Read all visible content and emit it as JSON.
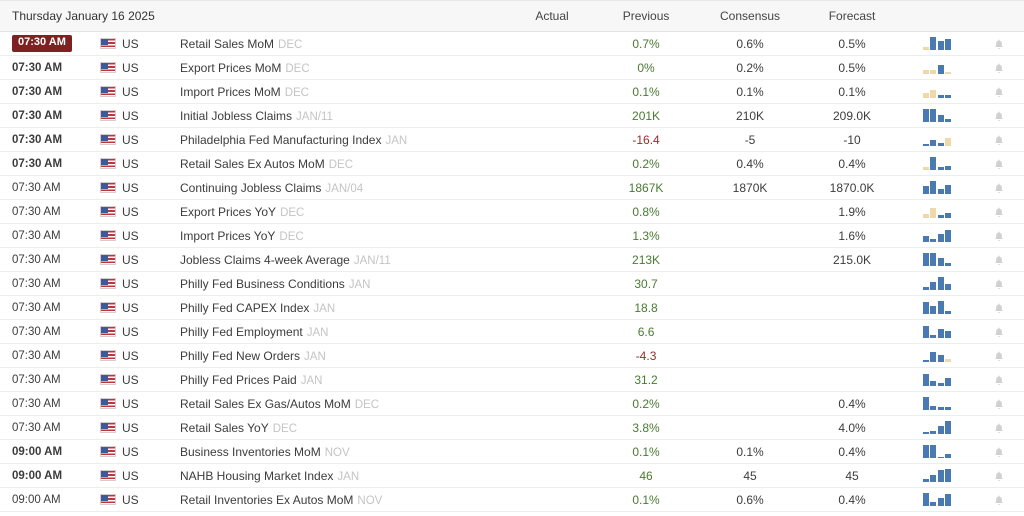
{
  "header": {
    "date_title": "Thursday January 16 2025",
    "columns": {
      "actual": "Actual",
      "previous": "Previous",
      "consensus": "Consensus",
      "forecast": "Forecast"
    }
  },
  "colors": {
    "previous_positive": "#4a7a33",
    "previous_negative": "#9b2a2a",
    "highlight_badge": "#7d2221",
    "spark_blue": "#4a7ab2",
    "spark_tan": "#f0d9a8",
    "header_bg": "#f7f7f7",
    "row_border": "#ededed",
    "reference_text": "#c4c4c4"
  },
  "icons": {
    "flag": "us-flag-icon",
    "alert": "bell-icon",
    "chart": "sparkline-bar-chart-icon"
  },
  "rows": [
    {
      "time": "07:30 AM",
      "time_highlighted": true,
      "time_bold": true,
      "country": "US",
      "event": "Retail Sales MoM",
      "reference": "DEC",
      "actual": "",
      "previous": "0.7%",
      "previous_negative": false,
      "consensus": "0.6%",
      "forecast": "0.5%",
      "spark": [
        {
          "h": 3,
          "tan": true
        },
        {
          "h": 13,
          "tan": false
        },
        {
          "h": 9,
          "tan": false
        },
        {
          "h": 11,
          "tan": false
        }
      ]
    },
    {
      "time": "07:30 AM",
      "time_highlighted": false,
      "time_bold": true,
      "country": "US",
      "event": "Export Prices MoM",
      "reference": "DEC",
      "actual": "",
      "previous": "0%",
      "previous_negative": false,
      "consensus": "0.2%",
      "forecast": "0.5%",
      "spark": [
        {
          "h": 4,
          "tan": true
        },
        {
          "h": 4,
          "tan": true
        },
        {
          "h": 9,
          "tan": false
        },
        {
          "h": 2,
          "tan": true
        }
      ]
    },
    {
      "time": "07:30 AM",
      "time_highlighted": false,
      "time_bold": true,
      "country": "US",
      "event": "Import Prices MoM",
      "reference": "DEC",
      "actual": "",
      "previous": "0.1%",
      "previous_negative": false,
      "consensus": "0.1%",
      "forecast": "0.1%",
      "spark": [
        {
          "h": 5,
          "tan": true
        },
        {
          "h": 8,
          "tan": true
        },
        {
          "h": 3,
          "tan": false
        },
        {
          "h": 3,
          "tan": false
        }
      ]
    },
    {
      "time": "07:30 AM",
      "time_highlighted": false,
      "time_bold": true,
      "country": "US",
      "event": "Initial Jobless Claims",
      "reference": "JAN/11",
      "actual": "",
      "previous": "201K",
      "previous_negative": false,
      "consensus": "210K",
      "forecast": "209.0K",
      "spark": [
        {
          "h": 13,
          "tan": false
        },
        {
          "h": 13,
          "tan": false
        },
        {
          "h": 7,
          "tan": false
        },
        {
          "h": 3,
          "tan": false
        }
      ]
    },
    {
      "time": "07:30 AM",
      "time_highlighted": false,
      "time_bold": true,
      "country": "US",
      "event": "Philadelphia Fed Manufacturing Index",
      "reference": "JAN",
      "actual": "",
      "previous": "-16.4",
      "previous_negative": true,
      "consensus": "-5",
      "forecast": "-10",
      "spark": [
        {
          "h": 2,
          "tan": false
        },
        {
          "h": 6,
          "tan": false
        },
        {
          "h": 3,
          "tan": false
        },
        {
          "h": 8,
          "tan": true
        }
      ]
    },
    {
      "time": "07:30 AM",
      "time_highlighted": false,
      "time_bold": true,
      "country": "US",
      "event": "Retail Sales Ex Autos MoM",
      "reference": "DEC",
      "actual": "",
      "previous": "0.2%",
      "previous_negative": false,
      "consensus": "0.4%",
      "forecast": "0.4%",
      "spark": [
        {
          "h": 3,
          "tan": true
        },
        {
          "h": 13,
          "tan": false
        },
        {
          "h": 3,
          "tan": false
        },
        {
          "h": 4,
          "tan": false
        }
      ]
    },
    {
      "time": "07:30 AM",
      "time_highlighted": false,
      "time_bold": false,
      "country": "US",
      "event": "Continuing Jobless Claims",
      "reference": "JAN/04",
      "actual": "",
      "previous": "1867K",
      "previous_negative": false,
      "consensus": "1870K",
      "forecast": "1870.0K",
      "spark": [
        {
          "h": 8,
          "tan": false
        },
        {
          "h": 13,
          "tan": false
        },
        {
          "h": 5,
          "tan": false
        },
        {
          "h": 9,
          "tan": false
        }
      ]
    },
    {
      "time": "07:30 AM",
      "time_highlighted": false,
      "time_bold": false,
      "country": "US",
      "event": "Export Prices YoY",
      "reference": "DEC",
      "actual": "",
      "previous": "0.8%",
      "previous_negative": false,
      "consensus": "",
      "forecast": "1.9%",
      "spark": [
        {
          "h": 4,
          "tan": true
        },
        {
          "h": 10,
          "tan": true
        },
        {
          "h": 3,
          "tan": false
        },
        {
          "h": 5,
          "tan": false
        }
      ]
    },
    {
      "time": "07:30 AM",
      "time_highlighted": false,
      "time_bold": false,
      "country": "US",
      "event": "Import Prices YoY",
      "reference": "DEC",
      "actual": "",
      "previous": "1.3%",
      "previous_negative": false,
      "consensus": "",
      "forecast": "1.6%",
      "spark": [
        {
          "h": 6,
          "tan": false
        },
        {
          "h": 3,
          "tan": false
        },
        {
          "h": 8,
          "tan": false
        },
        {
          "h": 12,
          "tan": false
        }
      ]
    },
    {
      "time": "07:30 AM",
      "time_highlighted": false,
      "time_bold": false,
      "country": "US",
      "event": "Jobless Claims 4-week Average",
      "reference": "JAN/11",
      "actual": "",
      "previous": "213K",
      "previous_negative": false,
      "consensus": "",
      "forecast": "215.0K",
      "spark": [
        {
          "h": 13,
          "tan": false
        },
        {
          "h": 13,
          "tan": false
        },
        {
          "h": 8,
          "tan": false
        },
        {
          "h": 3,
          "tan": false
        }
      ]
    },
    {
      "time": "07:30 AM",
      "time_highlighted": false,
      "time_bold": false,
      "country": "US",
      "event": "Philly Fed Business Conditions",
      "reference": "JAN",
      "actual": "",
      "previous": "30.7",
      "previous_negative": false,
      "consensus": "",
      "forecast": "",
      "spark": [
        {
          "h": 3,
          "tan": false
        },
        {
          "h": 8,
          "tan": false
        },
        {
          "h": 13,
          "tan": false
        },
        {
          "h": 6,
          "tan": false
        }
      ]
    },
    {
      "time": "07:30 AM",
      "time_highlighted": false,
      "time_bold": false,
      "country": "US",
      "event": "Philly Fed CAPEX Index",
      "reference": "JAN",
      "actual": "",
      "previous": "18.8",
      "previous_negative": false,
      "consensus": "",
      "forecast": "",
      "spark": [
        {
          "h": 12,
          "tan": false
        },
        {
          "h": 8,
          "tan": false
        },
        {
          "h": 13,
          "tan": false
        },
        {
          "h": 3,
          "tan": false
        }
      ]
    },
    {
      "time": "07:30 AM",
      "time_highlighted": false,
      "time_bold": false,
      "country": "US",
      "event": "Philly Fed Employment",
      "reference": "JAN",
      "actual": "",
      "previous": "6.6",
      "previous_negative": false,
      "consensus": "",
      "forecast": "",
      "spark": [
        {
          "h": 12,
          "tan": false
        },
        {
          "h": 3,
          "tan": false
        },
        {
          "h": 9,
          "tan": false
        },
        {
          "h": 7,
          "tan": false
        }
      ]
    },
    {
      "time": "07:30 AM",
      "time_highlighted": false,
      "time_bold": false,
      "country": "US",
      "event": "Philly Fed New Orders",
      "reference": "JAN",
      "actual": "",
      "previous": "-4.3",
      "previous_negative": true,
      "consensus": "",
      "forecast": "",
      "spark": [
        {
          "h": 2,
          "tan": false
        },
        {
          "h": 10,
          "tan": false
        },
        {
          "h": 7,
          "tan": false
        },
        {
          "h": 3,
          "tan": true
        }
      ]
    },
    {
      "time": "07:30 AM",
      "time_highlighted": false,
      "time_bold": false,
      "country": "US",
      "event": "Philly Fed Prices Paid",
      "reference": "JAN",
      "actual": "",
      "previous": "31.2",
      "previous_negative": false,
      "consensus": "",
      "forecast": "",
      "spark": [
        {
          "h": 12,
          "tan": false
        },
        {
          "h": 5,
          "tan": false
        },
        {
          "h": 3,
          "tan": false
        },
        {
          "h": 8,
          "tan": false
        }
      ]
    },
    {
      "time": "07:30 AM",
      "time_highlighted": false,
      "time_bold": false,
      "country": "US",
      "event": "Retail Sales Ex Gas/Autos MoM",
      "reference": "DEC",
      "actual": "",
      "previous": "0.2%",
      "previous_negative": false,
      "consensus": "",
      "forecast": "0.4%",
      "spark": [
        {
          "h": 13,
          "tan": false
        },
        {
          "h": 4,
          "tan": false
        },
        {
          "h": 3,
          "tan": false
        },
        {
          "h": 3,
          "tan": false
        }
      ]
    },
    {
      "time": "07:30 AM",
      "time_highlighted": false,
      "time_bold": false,
      "country": "US",
      "event": "Retail Sales YoY",
      "reference": "DEC",
      "actual": "",
      "previous": "3.8%",
      "previous_negative": false,
      "consensus": "",
      "forecast": "4.0%",
      "spark": [
        {
          "h": 2,
          "tan": false
        },
        {
          "h": 3,
          "tan": false
        },
        {
          "h": 8,
          "tan": false
        },
        {
          "h": 13,
          "tan": false
        }
      ]
    },
    {
      "time": "09:00 AM",
      "time_highlighted": false,
      "time_bold": true,
      "country": "US",
      "event": "Business Inventories MoM",
      "reference": "NOV",
      "actual": "",
      "previous": "0.1%",
      "previous_negative": false,
      "consensus": "0.1%",
      "forecast": "0.4%",
      "spark": [
        {
          "h": 13,
          "tan": false
        },
        {
          "h": 13,
          "tan": false
        },
        {
          "h": 1,
          "tan": false
        },
        {
          "h": 4,
          "tan": false
        }
      ]
    },
    {
      "time": "09:00 AM",
      "time_highlighted": false,
      "time_bold": true,
      "country": "US",
      "event": "NAHB Housing Market Index",
      "reference": "JAN",
      "actual": "",
      "previous": "46",
      "previous_negative": false,
      "consensus": "45",
      "forecast": "45",
      "spark": [
        {
          "h": 3,
          "tan": false
        },
        {
          "h": 7,
          "tan": false
        },
        {
          "h": 12,
          "tan": false
        },
        {
          "h": 13,
          "tan": false
        }
      ]
    },
    {
      "time": "09:00 AM",
      "time_highlighted": false,
      "time_bold": false,
      "country": "US",
      "event": "Retail Inventories Ex Autos MoM",
      "reference": "NOV",
      "actual": "",
      "previous": "0.1%",
      "previous_negative": false,
      "consensus": "0.6%",
      "forecast": "0.4%",
      "spark": [
        {
          "h": 13,
          "tan": false
        },
        {
          "h": 4,
          "tan": false
        },
        {
          "h": 8,
          "tan": false
        },
        {
          "h": 12,
          "tan": false
        }
      ]
    }
  ]
}
